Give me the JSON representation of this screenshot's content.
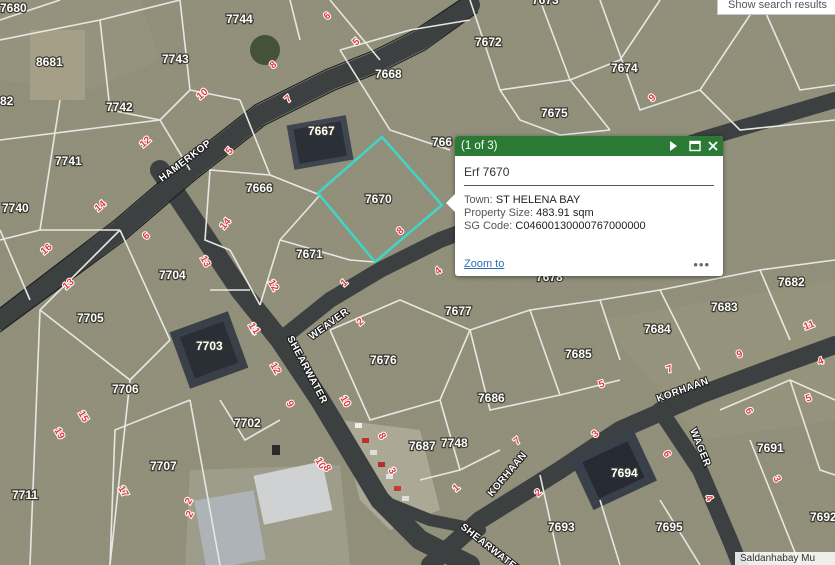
{
  "search": {
    "label": "Show search results"
  },
  "attribution": "Saldanhabay Mu",
  "popup": {
    "counter": "(1 of 3)",
    "title": "Erf 7670",
    "fields": [
      {
        "label": "Town:",
        "value": "ST HELENA BAY"
      },
      {
        "label": "Property Size:",
        "value": "483.91 sqm"
      },
      {
        "label": "SG Code:",
        "value": "C04600130000767000000"
      }
    ],
    "zoom_label": "Zoom to",
    "more_label": "•••",
    "icons": [
      "next-arrow-icon",
      "maximize-icon",
      "close-icon"
    ]
  },
  "highlight_color": "#3fd6c8",
  "streets": [
    "HAMERKOP",
    "WEAVER",
    "SHEARWATER",
    "KORHAAN",
    "KORHAAN",
    "WAGER",
    "SHEARWATER"
  ],
  "parcels": [
    "7680",
    "8681",
    "7744",
    "7743",
    "7742",
    "7741",
    "7740",
    "7673",
    "7672",
    "7674",
    "7668",
    "7675",
    "7667",
    "766",
    "7666",
    "7670",
    "7671",
    "7704",
    "7705",
    "7703",
    "7706",
    "7702",
    "7707",
    "7711",
    "7677",
    "7676",
    "7686",
    "7687",
    "7748",
    "7678",
    "7682",
    "7683",
    "7684",
    "7685",
    "7691",
    "7694",
    "7693",
    "7695",
    "7692",
    "82"
  ],
  "house_numbers": [
    "6",
    "5",
    "8",
    "7",
    "10",
    "12",
    "5",
    "14",
    "13",
    "16",
    "6",
    "14",
    "13",
    "11",
    "12",
    "8",
    "4",
    "1",
    "3",
    "12",
    "2",
    "11",
    "9",
    "15",
    "10",
    "8",
    "9",
    "7",
    "10",
    "17",
    "19",
    "6",
    "4",
    "9",
    "7",
    "5",
    "3",
    "1",
    "6",
    "2",
    "3",
    "5",
    "2",
    "4",
    "8",
    "2",
    "1"
  ]
}
